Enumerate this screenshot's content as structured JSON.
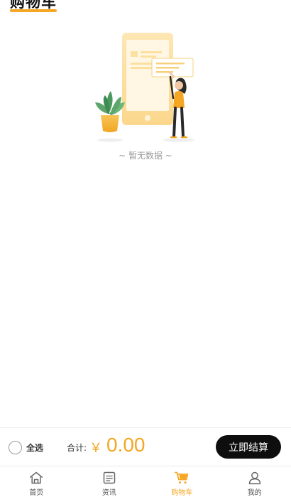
{
  "header": {
    "title": "购物车"
  },
  "empty_state": {
    "message": "~ 暂无数据 ~",
    "icon": "empty-cart-illustration"
  },
  "bottom_bar": {
    "select_all_label": "全选",
    "total_label": "合计:",
    "currency": "￥",
    "total_amount": "0.00",
    "checkout_label": "立即结算"
  },
  "tabbar": {
    "items": [
      {
        "label": "首页",
        "icon": "home-icon"
      },
      {
        "label": "资讯",
        "icon": "news-icon"
      },
      {
        "label": "购物车",
        "icon": "cart-icon",
        "active": true
      },
      {
        "label": "我的",
        "icon": "user-icon"
      }
    ]
  },
  "colors": {
    "accent": "#f5a623",
    "checkout_bg": "#0e0e0e",
    "text": "#333333"
  }
}
